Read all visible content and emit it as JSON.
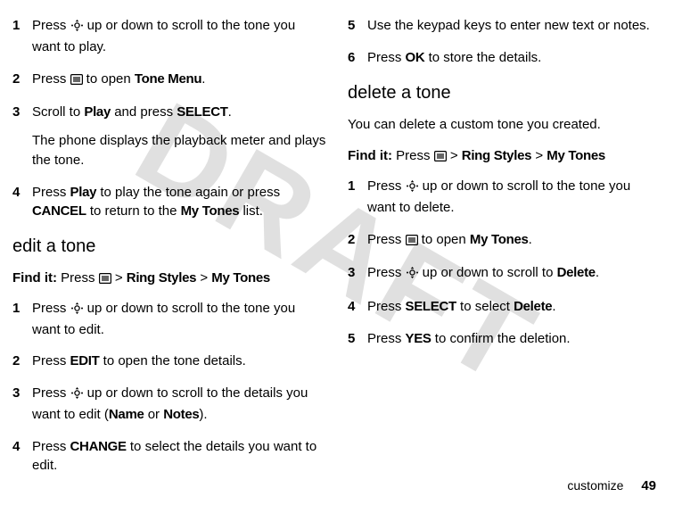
{
  "watermark": "DRAFT",
  "left": {
    "steps_a": [
      {
        "n": "1",
        "parts": [
          "Press ",
          {
            "icon": "nav"
          },
          " up or down to scroll to the tone you want to play."
        ]
      },
      {
        "n": "2",
        "parts": [
          "Press ",
          {
            "icon": "menu"
          },
          " to open ",
          {
            "cond": "Tone Menu"
          },
          "."
        ]
      },
      {
        "n": "3",
        "parts": [
          "Scroll to ",
          {
            "cond": "Play"
          },
          " and press ",
          {
            "cond": "SELECT"
          },
          "."
        ],
        "extra": [
          "The phone displays the playback meter and plays the tone."
        ]
      },
      {
        "n": "4",
        "parts": [
          "Press ",
          {
            "cond": "Play"
          },
          " to play the tone again or press ",
          {
            "cond": "CANCEL"
          },
          " to return to the ",
          {
            "cond": "My Tones"
          },
          " list."
        ]
      }
    ],
    "section": "edit a tone",
    "findit": [
      "Find it:",
      " Press ",
      {
        "icon": "menu"
      },
      " > ",
      {
        "cond": "Ring Styles"
      },
      " > ",
      {
        "cond": "My Tones"
      }
    ],
    "steps_b": [
      {
        "n": "1",
        "parts": [
          "Press ",
          {
            "icon": "nav"
          },
          " up or down to scroll to the tone you want to edit."
        ]
      },
      {
        "n": "2",
        "parts": [
          "Press ",
          {
            "cond": "EDIT"
          },
          " to open the tone details."
        ]
      },
      {
        "n": "3",
        "parts": [
          "Press ",
          {
            "icon": "nav"
          },
          " up or down to scroll to the details you want to edit (",
          {
            "cond": "Name"
          },
          " or ",
          {
            "cond": "Notes"
          },
          ")."
        ]
      },
      {
        "n": "4",
        "parts": [
          "Press ",
          {
            "cond": "CHANGE"
          },
          " to select the details you want to edit."
        ]
      }
    ]
  },
  "right": {
    "steps_a": [
      {
        "n": "5",
        "parts": [
          "Use the keypad keys to enter new text or notes."
        ]
      },
      {
        "n": "6",
        "parts": [
          "Press ",
          {
            "cond": "OK"
          },
          " to store the details."
        ]
      }
    ],
    "section": "delete a tone",
    "para": "You can delete a custom tone you created.",
    "findit": [
      "Find it:",
      " Press ",
      {
        "icon": "menu"
      },
      " > ",
      {
        "cond": "Ring Styles"
      },
      " > ",
      {
        "cond": "My Tones"
      }
    ],
    "steps_b": [
      {
        "n": "1",
        "parts": [
          "Press ",
          {
            "icon": "nav"
          },
          " up or down to scroll to the tone you want to delete."
        ]
      },
      {
        "n": "2",
        "parts": [
          "Press ",
          {
            "icon": "menu"
          },
          " to open ",
          {
            "cond": "My Tones"
          },
          "."
        ]
      },
      {
        "n": "3",
        "parts": [
          "Press ",
          {
            "icon": "nav"
          },
          " up or down to scroll to ",
          {
            "cond": "Delete"
          },
          "."
        ]
      },
      {
        "n": "4",
        "parts": [
          "Press ",
          {
            "cond": "SELECT"
          },
          " to select ",
          {
            "cond": "Delete"
          },
          "."
        ]
      },
      {
        "n": "5",
        "parts": [
          "Press ",
          {
            "cond": "YES"
          },
          " to confirm the deletion."
        ]
      }
    ]
  },
  "footer": {
    "label": "customize",
    "page": "49"
  }
}
